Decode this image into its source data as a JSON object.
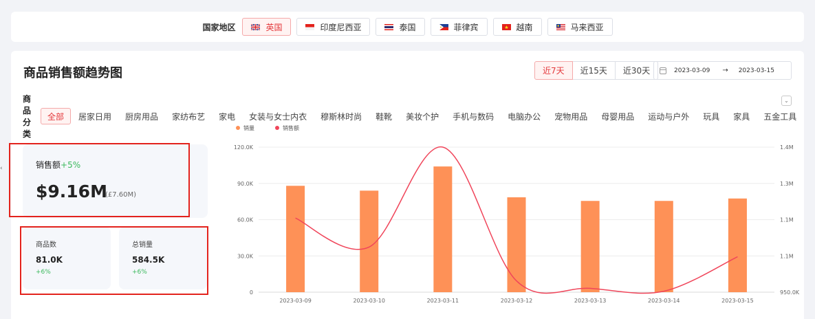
{
  "topbar": {
    "label": "国家地区",
    "countries": [
      {
        "name": "英国",
        "active": true,
        "flag": "uk-flag-icon"
      },
      {
        "name": "印度尼西亚",
        "active": false,
        "flag": "indonesia-flag-icon"
      },
      {
        "name": "泰国",
        "active": false,
        "flag": "thailand-flag-icon"
      },
      {
        "name": "菲律宾",
        "active": false,
        "flag": "philippines-flag-icon"
      },
      {
        "name": "越南",
        "active": false,
        "flag": "vietnam-flag-icon"
      },
      {
        "name": "马来西亚",
        "active": false,
        "flag": "malaysia-flag-icon"
      }
    ]
  },
  "panel": {
    "title": "商品销售额趋势图",
    "ranges": [
      "近7天",
      "近15天",
      "近30天"
    ],
    "active_range": "近7天",
    "date_start": "2023-03-09",
    "date_sep": "→",
    "date_end": "2023-03-15",
    "category_label": "商品分类",
    "categories": [
      "全部",
      "居家日用",
      "厨房用品",
      "家纺布艺",
      "家电",
      "女装与女士内衣",
      "穆斯林时尚",
      "鞋靴",
      "美妆个护",
      "手机与数码",
      "电脑办公",
      "宠物用品",
      "母婴用品",
      "运动与户外",
      "玩具",
      "家具",
      "五金工具"
    ],
    "active_category": "全部",
    "expand_icon": "chevron-down-icon"
  },
  "stats": {
    "sales_label": "销售额",
    "sales_change": "+5%",
    "sales_value": "$9.16M",
    "sales_sub": "(£7.60M)",
    "products_label": "商品数",
    "products_value": "81.0K",
    "products_change": "+6%",
    "volume_label": "总销量",
    "volume_value": "584.5K",
    "volume_change": "+6%"
  },
  "colors": {
    "accent": "#e4393c",
    "bar": "#fe9157",
    "line": "#f0455a",
    "positive": "#3cb95d",
    "highlight_box": "#e3221c"
  },
  "chart_data": {
    "type": "bar",
    "categories": [
      "2023-03-09",
      "2023-03-10",
      "2023-03-11",
      "2023-03-12",
      "2023-03-13",
      "2023-03-14",
      "2023-03-15"
    ],
    "series": [
      {
        "name": "销量",
        "type": "bar",
        "axis": "left",
        "values": [
          88000,
          84000,
          104000,
          78500,
          75500,
          75500,
          77500
        ]
      },
      {
        "name": "销售额",
        "type": "line",
        "axis": "right",
        "values": [
          1180000,
          1090000,
          1400000,
          985000,
          962000,
          953000,
          1060000
        ]
      }
    ],
    "left_axis": {
      "ticks": [
        "0",
        "30.0K",
        "60.0K",
        "90.0K",
        "120.0K"
      ],
      "ylim": [
        0,
        120000
      ]
    },
    "right_axis": {
      "ticks": [
        "950.0K",
        "1.1M",
        "1.1M",
        "1.3M",
        "1.4M"
      ],
      "ylim": [
        950000,
        1400000
      ]
    },
    "grid": true,
    "legend_position": "top-left"
  }
}
